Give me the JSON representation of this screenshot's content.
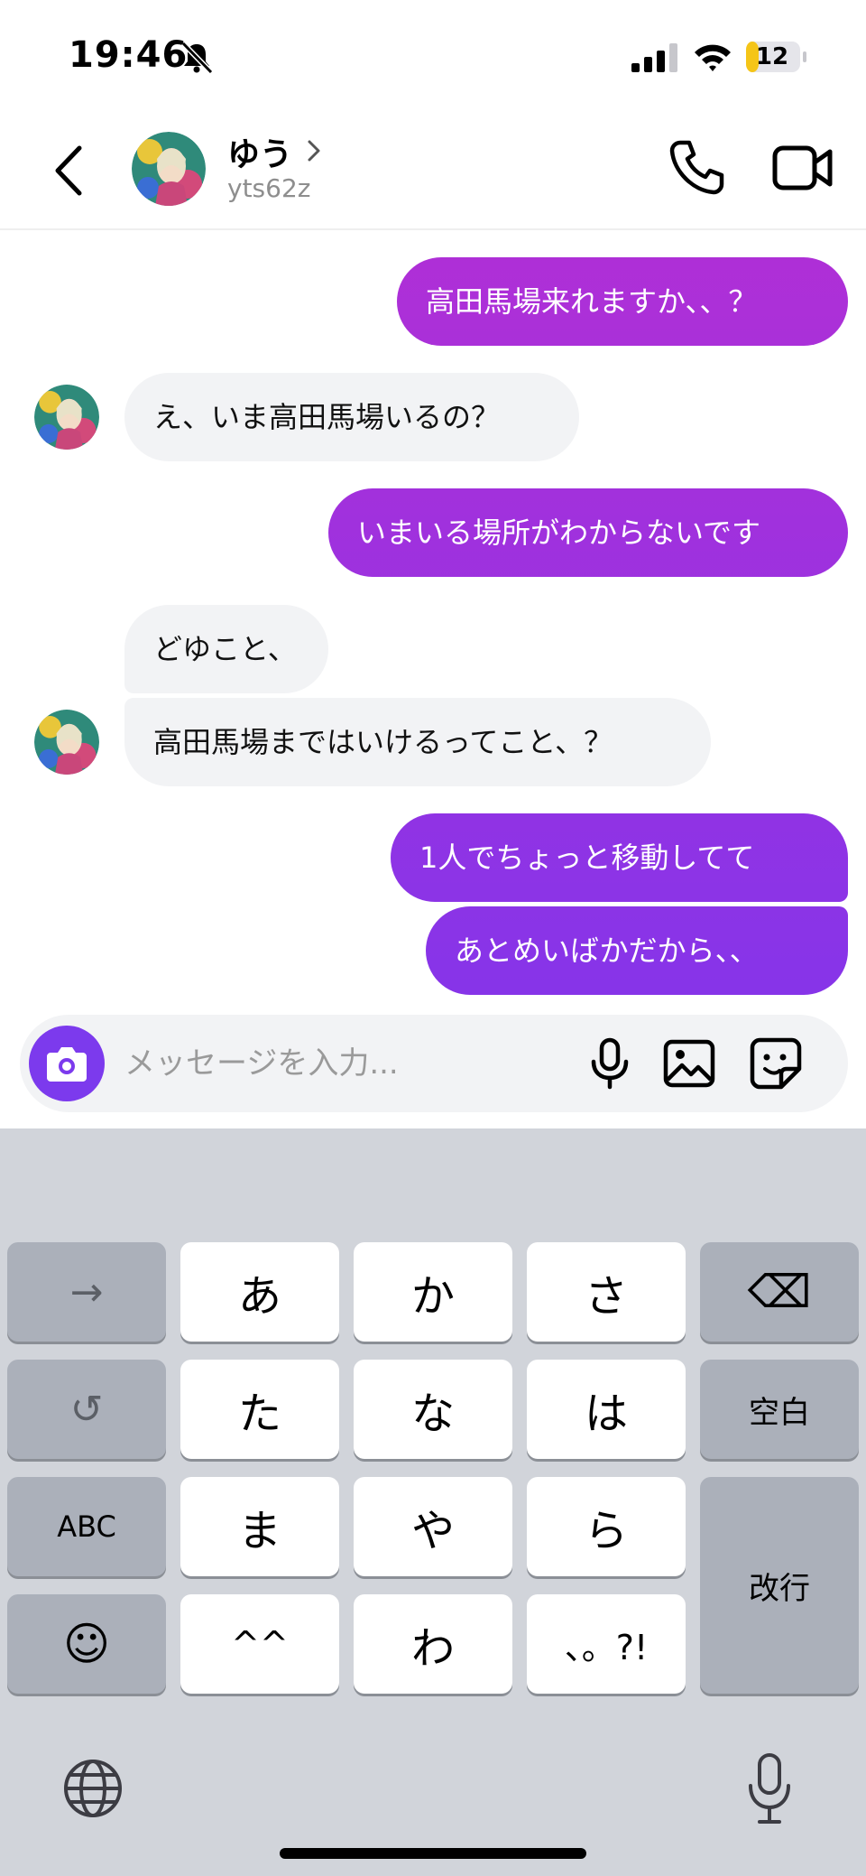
{
  "status_bar": {
    "time": "19:46",
    "battery_level": "12",
    "icons": [
      "bell-slash-icon",
      "cellular-signal-icon",
      "wifi-icon",
      "battery-icon"
    ]
  },
  "header": {
    "contact_name": "ゆう",
    "contact_handle": "yts62z",
    "icons": [
      "back-chevron-icon",
      "chevron-right-icon",
      "phone-icon",
      "video-camera-icon"
    ]
  },
  "messages": [
    {
      "direction": "outgoing",
      "text": "高田馬場来れますか、、？"
    },
    {
      "direction": "incoming",
      "text": "え、いま高田馬場いるの？"
    },
    {
      "direction": "outgoing",
      "text": "いまいる場所がわからないです"
    },
    {
      "direction": "incoming",
      "text": "どゆこと、"
    },
    {
      "direction": "incoming",
      "text": "高田馬場まではいけるってこと、？"
    },
    {
      "direction": "outgoing",
      "text": "1人でちょっと移動してて"
    },
    {
      "direction": "outgoing",
      "text": "あとめいばかだから、、"
    }
  ],
  "composer": {
    "placeholder": "メッセージを入力...",
    "value": "",
    "icons": [
      "camera-icon",
      "microphone-icon",
      "image-icon",
      "sticker-icon"
    ]
  },
  "keyboard": {
    "row1": [
      "→",
      "あ",
      "か",
      "さ",
      "⌫"
    ],
    "row2": [
      "↺",
      "た",
      "な",
      "は",
      "空白"
    ],
    "row3": [
      "ABC",
      "ま",
      "や",
      "ら",
      "改行"
    ],
    "row4": [
      "☺",
      "^^",
      "わ",
      "、。?!"
    ],
    "icons": [
      "arrow-right-icon",
      "delete-icon",
      "undo-icon",
      "emoji-icon",
      "globe-icon",
      "dictation-mic-icon"
    ]
  },
  "colors": {
    "accent": "#7c3aed",
    "bubble_gradient_top": "#b02fd6",
    "bubble_gradient_bottom": "#7a36ee",
    "incoming_bubble": "#f2f3f5",
    "keyboard_bg": "#d1d4da"
  }
}
